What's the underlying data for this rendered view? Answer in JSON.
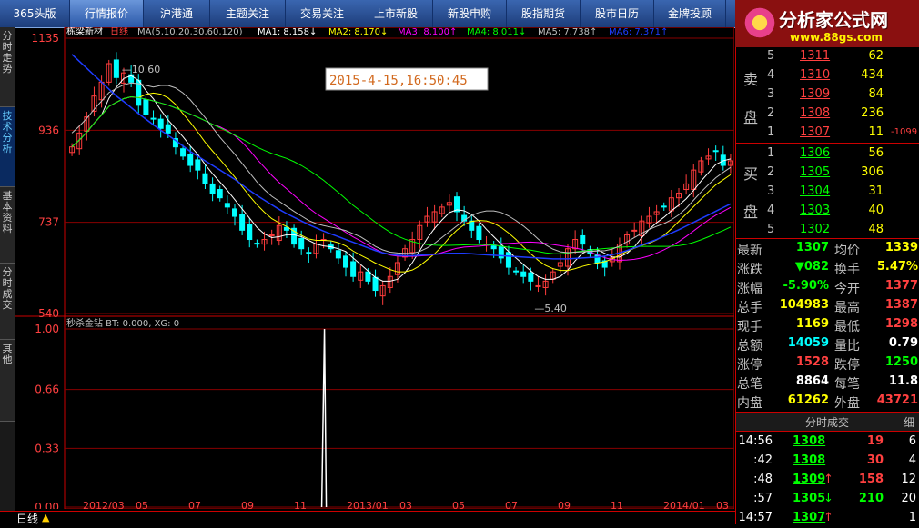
{
  "menu": {
    "items": [
      "365头版",
      "行情报价",
      "沪港通",
      "主题关注",
      "交易关注",
      "上市新股",
      "新股申购",
      "股指期货",
      "股市日历",
      "金牌投顾"
    ],
    "active_index": 1
  },
  "logo": {
    "name": "分析家公式网",
    "url": "www.88gs.com"
  },
  "left_tabs": [
    "分时走势",
    "技术分析",
    "基本资料",
    "分时成交",
    "其他"
  ],
  "chart_header": {
    "stock": "栋梁新材",
    "period": "日线",
    "ma_params": "MA(5,10,20,30,60,120)",
    "ma1": "MA1: 8.158↓",
    "ma2": "MA2: 8.170↓",
    "ma3": "MA3: 8.100↑",
    "ma4": "MA4: 8.011↓",
    "ma5": "MA5: 7.738↑",
    "ma6": "MA6: 7.371↑"
  },
  "date_label": "2015-4-15,16:50:45",
  "high_marker": "10.60",
  "low_marker": "5.40",
  "sub_indicator": "秒杀金钻 BT: 0.000, XG: 0",
  "colors": {
    "up": "#ff3c3c",
    "down": "#00ffff",
    "ma1": "#ffffff",
    "ma2": "#ffff00",
    "ma3": "#ff00ff",
    "ma4": "#00ff00",
    "ma6": "#1e3cff",
    "ma5": "#c0c0c0"
  },
  "chart_data": [
    {
      "type": "candlestick",
      "y_ticks": [
        "1135",
        "936",
        "737",
        "540"
      ],
      "ylim": [
        540,
        1135
      ],
      "x_ticks": [
        "2012/03",
        "05",
        "07",
        "09",
        "11",
        "2013/01",
        "03",
        "05",
        "07",
        "09",
        "11",
        "2014/01",
        "03"
      ],
      "close_series": [
        900,
        930,
        965,
        1010,
        1040,
        1080,
        1050,
        1060,
        1040,
        990,
        970,
        960,
        940,
        930,
        900,
        880,
        860,
        850,
        820,
        800,
        790,
        770,
        750,
        720,
        700,
        690,
        700,
        710,
        730,
        720,
        690,
        680,
        670,
        690,
        700,
        680,
        660,
        640,
        620,
        630,
        610,
        590,
        600,
        620,
        650,
        680,
        700,
        730,
        750,
        760,
        770,
        780,
        760,
        740,
        720,
        700,
        690,
        680,
        660,
        640,
        630,
        620,
        610,
        600,
        610,
        630,
        650,
        680,
        700,
        690,
        670,
        650,
        640,
        660,
        690,
        710,
        720,
        740,
        750,
        760,
        770,
        790,
        800,
        820,
        850,
        870,
        880,
        890,
        860,
        870
      ],
      "ma60_series": [
        1100,
        1085,
        1070,
        1055,
        1040,
        1025,
        1010,
        998,
        985,
        972,
        960,
        948,
        936,
        925,
        914,
        902,
        890,
        880,
        870,
        860,
        850,
        840,
        830,
        818,
        806,
        795,
        785,
        775,
        765,
        756,
        748,
        740,
        732,
        725,
        718,
        712,
        706,
        700,
        694,
        688,
        682,
        676,
        671,
        668,
        666,
        665,
        665,
        666,
        667,
        668,
        669,
        670,
        670,
        670,
        669,
        668,
        667,
        666,
        665,
        664,
        663,
        662,
        661,
        660,
        659,
        658,
        658,
        658,
        659,
        660,
        661,
        662,
        664,
        667,
        671,
        676,
        682,
        688,
        694,
        700,
        707,
        714,
        721,
        729,
        737,
        745,
        753,
        761,
        769,
        777
      ]
    },
    {
      "type": "line",
      "y_ticks": [
        "1.00",
        "0.66",
        "0.33",
        "0.00"
      ],
      "ylim": [
        0,
        1
      ],
      "series": [
        {
          "values_note": "spike",
          "spike_x_fraction": 0.388,
          "spike_value": 1.0
        }
      ]
    }
  ],
  "ask": {
    "label": "卖盘",
    "rows": [
      {
        "level": "5",
        "price": "1311",
        "vol": "62"
      },
      {
        "level": "4",
        "price": "1310",
        "vol": "434"
      },
      {
        "level": "3",
        "price": "1309",
        "vol": "84"
      },
      {
        "level": "2",
        "price": "1308",
        "vol": "236"
      },
      {
        "level": "1",
        "price": "1307",
        "vol": "11"
      }
    ],
    "delta": "-1099"
  },
  "bid": {
    "label": "买盘",
    "rows": [
      {
        "level": "1",
        "price": "1306",
        "vol": "56"
      },
      {
        "level": "2",
        "price": "1305",
        "vol": "306"
      },
      {
        "level": "3",
        "price": "1304",
        "vol": "31"
      },
      {
        "level": "4",
        "price": "1303",
        "vol": "40"
      },
      {
        "level": "5",
        "price": "1302",
        "vol": "48"
      }
    ]
  },
  "quote": [
    {
      "l": "最新",
      "v": "1307",
      "l2": "均价",
      "v2": "1339"
    },
    {
      "l": "涨跌",
      "v": "▼082",
      "l2": "换手",
      "v2": "5.47%"
    },
    {
      "l": "涨幅",
      "v": "-5.90%",
      "l2": "今开",
      "v2": "1377"
    },
    {
      "l": "总手",
      "v": "104983",
      "l2": "最高",
      "v2": "1387"
    },
    {
      "l": "现手",
      "v": "1169",
      "l2": "最低",
      "v2": "1298"
    },
    {
      "l": "总额",
      "v": "14059",
      "l2": "量比",
      "v2": "0.79"
    },
    {
      "l": "涨停",
      "v": "1528",
      "l2": "跌停",
      "v2": "1250"
    },
    {
      "l": "总笔",
      "v": "8864",
      "l2": "每笔",
      "v2": "11.8"
    },
    {
      "l": "内盘",
      "v": "61262",
      "l2": "外盘",
      "v2": "43721"
    }
  ],
  "ticks_header": {
    "title": "分时成交",
    "detail": "细"
  },
  "ticks": [
    {
      "t": "14:56",
      "p": "1308",
      "v": "19",
      "n": "6",
      "dir": ""
    },
    {
      "t": ":42",
      "p": "1308",
      "v": "30",
      "n": "4",
      "dir": ""
    },
    {
      "t": ":48",
      "p": "1309",
      "v": "158",
      "n": "12",
      "dir": "up"
    },
    {
      "t": ":57",
      "p": "1305",
      "v": "210",
      "n": "20",
      "dir": "down"
    },
    {
      "t": "14:57",
      "p": "1307",
      "v": "",
      "n": "1",
      "dir": "up"
    }
  ],
  "bottom_label": "日线"
}
